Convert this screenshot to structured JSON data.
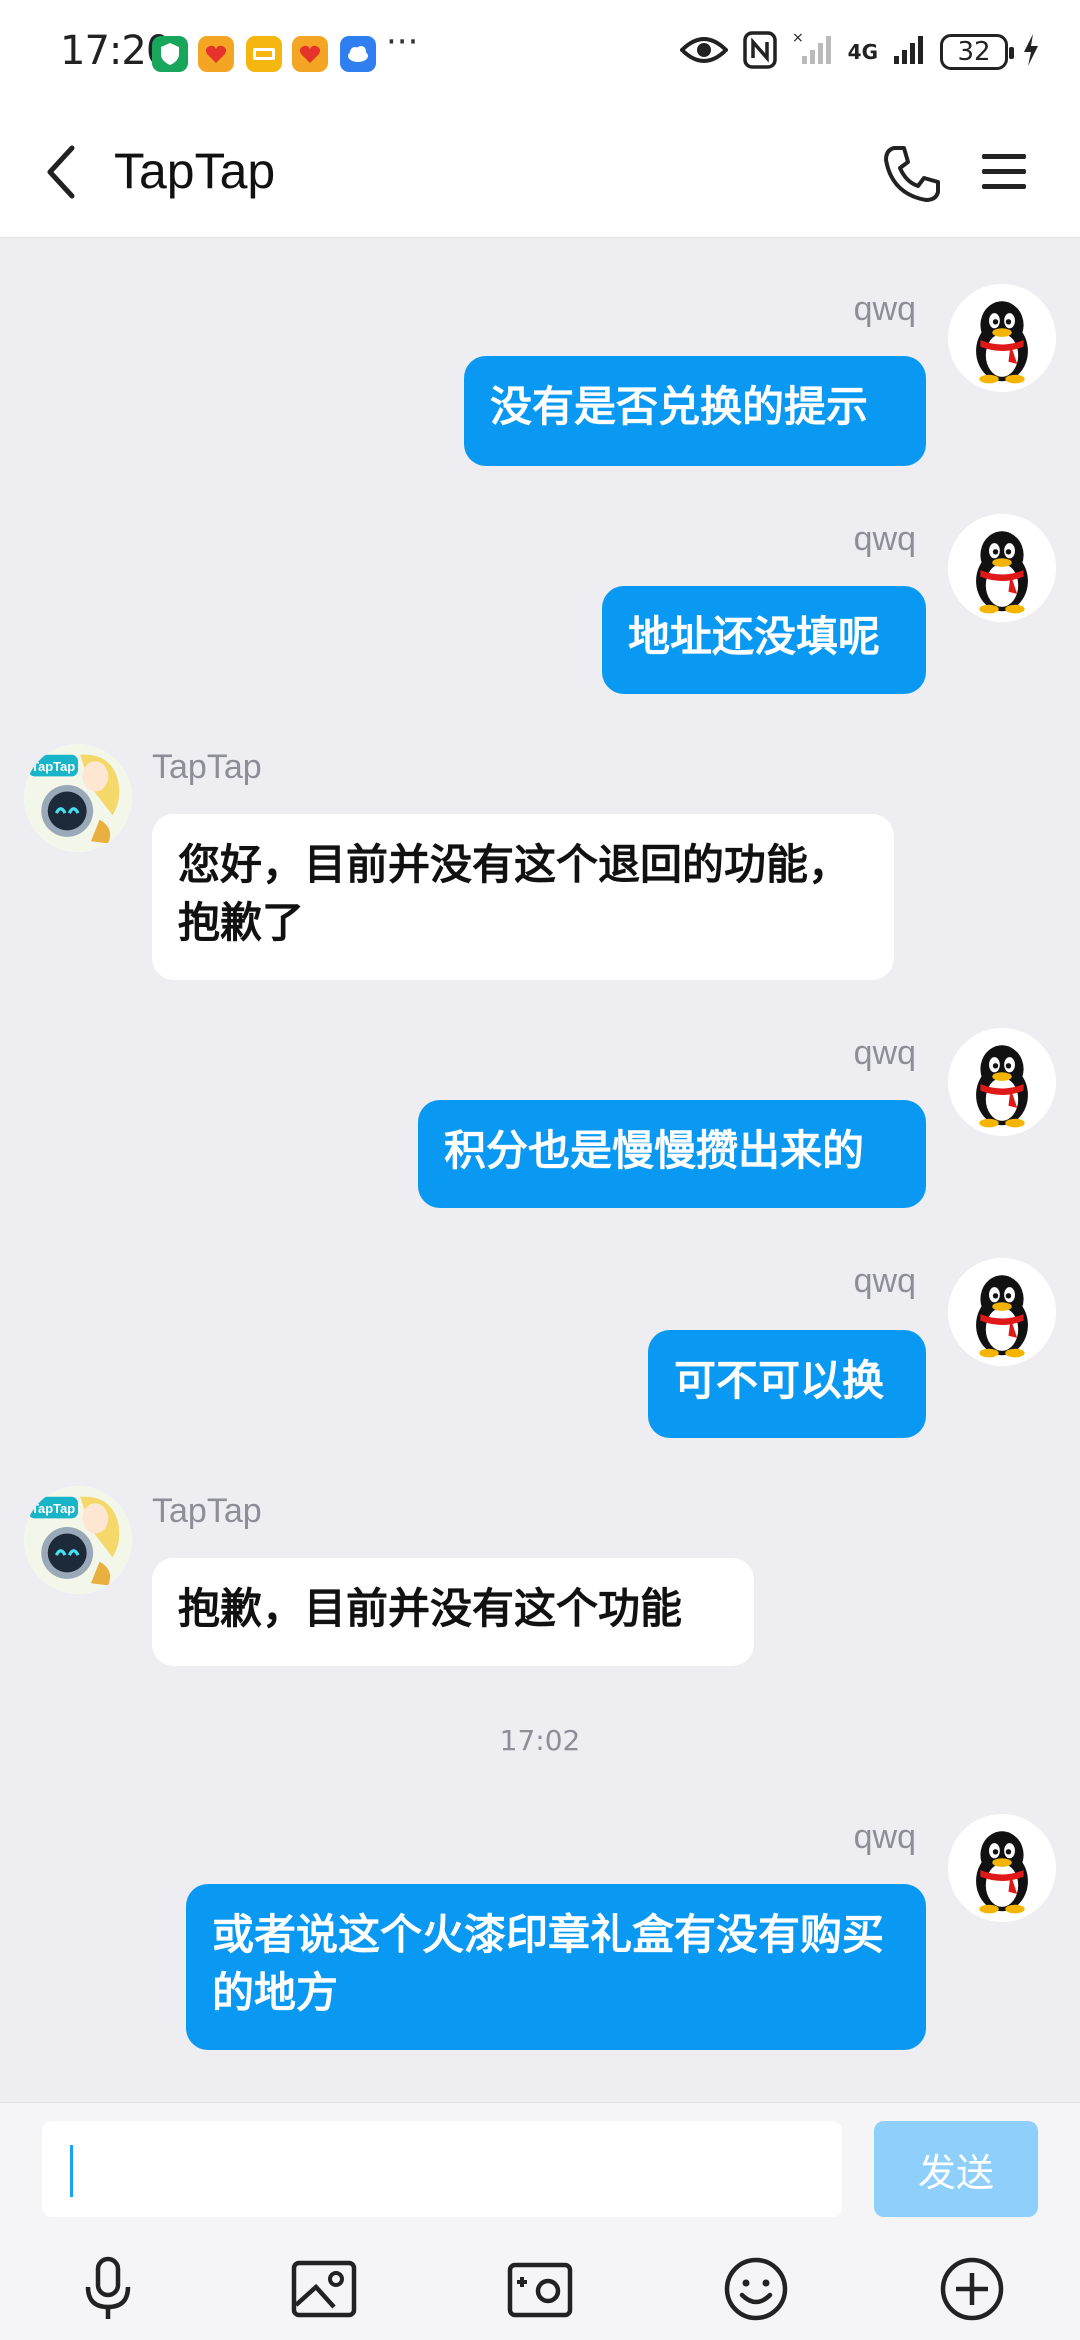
{
  "status_bar": {
    "time": "17:20",
    "battery": "32",
    "network": "4G",
    "more": "···"
  },
  "header": {
    "title": "TapTap"
  },
  "messages": [
    {
      "sender": "qwq",
      "text": "没有是否兑换的提示"
    },
    {
      "sender": "qwq",
      "text": "地址还没填呢"
    },
    {
      "sender": "TapTap",
      "text": "您好，目前并没有这个退回的功能，抱歉了"
    },
    {
      "sender": "qwq",
      "text": "积分也是慢慢攒出来的"
    },
    {
      "sender": "qwq",
      "text": "可不可以换"
    },
    {
      "sender": "TapTap",
      "text": "抱歉，目前并没有这个功能"
    },
    {
      "sender": "qwq",
      "text": "或者说这个火漆印章礼盒有没有购买的地方"
    }
  ],
  "timestamp": "17:02",
  "composer": {
    "input_value": "",
    "send_label": "发送"
  },
  "toolbar_icons": [
    "microphone-icon",
    "image-icon",
    "camera-icon",
    "emoji-icon",
    "plus-icon"
  ],
  "colors": {
    "outgoing_bubble": "#0a99f2",
    "incoming_bubble": "#ffffff",
    "background": "#ededf2",
    "send_disabled": "#8ed0fb"
  }
}
